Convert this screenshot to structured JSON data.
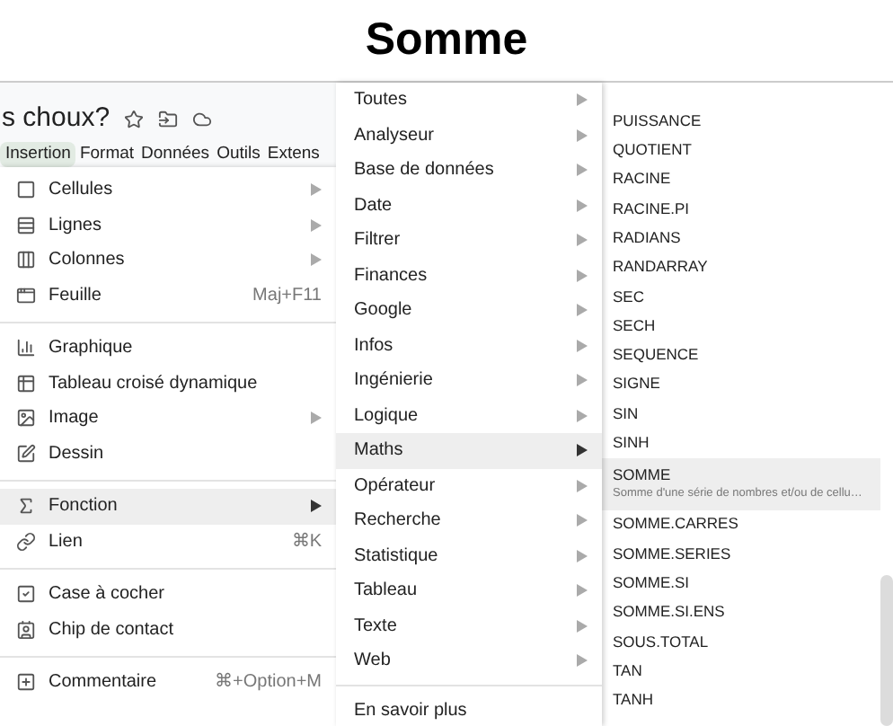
{
  "heading": "Somme",
  "document": {
    "title": "s choux?"
  },
  "menubar": [
    {
      "label": "Insertion",
      "selected": true
    },
    {
      "label": "Format",
      "selected": false
    },
    {
      "label": "Données",
      "selected": false
    },
    {
      "label": "Outils",
      "selected": false
    },
    {
      "label": "Extens",
      "selected": false
    }
  ],
  "insert_menu": [
    {
      "kind": "item",
      "label": "Cellules",
      "submenu": true,
      "selected": false
    },
    {
      "kind": "item",
      "label": "Lignes",
      "submenu": true,
      "selected": false
    },
    {
      "kind": "item",
      "label": "Colonnes",
      "submenu": true,
      "selected": false
    },
    {
      "kind": "item",
      "label": "Feuille",
      "shortcut": "Maj+F11",
      "submenu": false,
      "selected": false
    },
    {
      "kind": "separator"
    },
    {
      "kind": "item",
      "label": "Graphique",
      "submenu": false,
      "selected": false
    },
    {
      "kind": "item",
      "label": "Tableau croisé dynamique",
      "submenu": false,
      "selected": false
    },
    {
      "kind": "item",
      "label": "Image",
      "submenu": true,
      "selected": false
    },
    {
      "kind": "item",
      "label": "Dessin",
      "submenu": false,
      "selected": false
    },
    {
      "kind": "separator"
    },
    {
      "kind": "item",
      "label": "Fonction",
      "submenu": true,
      "selected": true
    },
    {
      "kind": "item",
      "label": "Lien",
      "shortcut": "⌘K",
      "submenu": false,
      "selected": false
    },
    {
      "kind": "separator"
    },
    {
      "kind": "item",
      "label": "Case à cocher",
      "submenu": false,
      "selected": false
    },
    {
      "kind": "item",
      "label": "Chip de contact",
      "submenu": false,
      "selected": false
    },
    {
      "kind": "separator"
    },
    {
      "kind": "item",
      "label": "Commentaire",
      "shortcut": "⌘+Option+M",
      "submenu": false,
      "selected": false
    }
  ],
  "function_categories": [
    {
      "kind": "item",
      "label": "Toutes",
      "selected": false
    },
    {
      "kind": "item",
      "label": "Analyseur",
      "selected": false
    },
    {
      "kind": "item",
      "label": "Base de données",
      "selected": false
    },
    {
      "kind": "item",
      "label": "Date",
      "selected": false
    },
    {
      "kind": "item",
      "label": "Filtrer",
      "selected": false
    },
    {
      "kind": "item",
      "label": "Finances",
      "selected": false
    },
    {
      "kind": "item",
      "label": "Google",
      "selected": false
    },
    {
      "kind": "item",
      "label": "Infos",
      "selected": false
    },
    {
      "kind": "item",
      "label": "Ingénierie",
      "selected": false
    },
    {
      "kind": "item",
      "label": "Logique",
      "selected": false
    },
    {
      "kind": "item",
      "label": "Maths",
      "selected": true
    },
    {
      "kind": "item",
      "label": "Opérateur",
      "selected": false
    },
    {
      "kind": "item",
      "label": "Recherche",
      "selected": false
    },
    {
      "kind": "item",
      "label": "Statistique",
      "selected": false
    },
    {
      "kind": "item",
      "label": "Tableau",
      "selected": false
    },
    {
      "kind": "item",
      "label": "Texte",
      "selected": false
    },
    {
      "kind": "item",
      "label": "Web",
      "selected": false
    },
    {
      "kind": "separator"
    },
    {
      "kind": "link",
      "label": "En savoir plus"
    }
  ],
  "math_functions": [
    {
      "label": "PUISSANCE",
      "selected": false
    },
    {
      "label": "QUOTIENT",
      "selected": false
    },
    {
      "label": "RACINE",
      "selected": false
    },
    {
      "label": "RACINE.PI",
      "selected": false
    },
    {
      "label": "RADIANS",
      "selected": false
    },
    {
      "label": "RANDARRAY",
      "selected": false
    },
    {
      "label": "SEC",
      "selected": false
    },
    {
      "label": "SECH",
      "selected": false
    },
    {
      "label": "SEQUENCE",
      "selected": false
    },
    {
      "label": "SIGNE",
      "selected": false
    },
    {
      "label": "SIN",
      "selected": false
    },
    {
      "label": "SINH",
      "selected": false
    },
    {
      "label": "SOMME",
      "description": "Somme d'une série de nombres et/ou de cellu…",
      "selected": true
    },
    {
      "label": "SOMME.CARRES",
      "selected": false
    },
    {
      "label": "SOMME.SERIES",
      "selected": false
    },
    {
      "label": "SOMME.SI",
      "selected": false
    },
    {
      "label": "SOMME.SI.ENS",
      "selected": false
    },
    {
      "label": "SOUS.TOTAL",
      "selected": false
    },
    {
      "label": "TAN",
      "selected": false
    },
    {
      "label": "TANH",
      "selected": false
    }
  ]
}
